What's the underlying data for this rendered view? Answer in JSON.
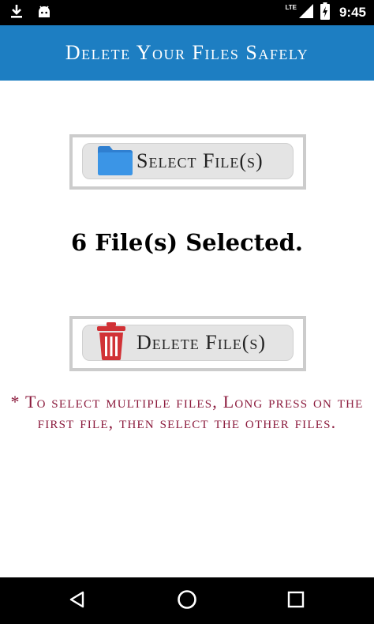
{
  "status_bar": {
    "network": "LTE",
    "time": "9:45",
    "icons": [
      "download-icon",
      "android-icon",
      "signal-icon",
      "battery-charging-icon"
    ]
  },
  "app_bar": {
    "title": "Delete Your Files Safely",
    "background_color": "#1d7ec2"
  },
  "select_button": {
    "label": "Select File(s)",
    "icon": "folder-icon",
    "icon_color": "#3b8fe0"
  },
  "selection_status": {
    "text": "6 File(s) Selected."
  },
  "delete_button": {
    "label": "Delete File(s)",
    "icon": "trash-icon",
    "icon_color": "#d13236"
  },
  "hint": {
    "text": "* To select multiple files, Long press on the first file, then select the other files.",
    "color": "#8b1a3c"
  },
  "nav_bar": {
    "icons": [
      "back-icon",
      "home-icon",
      "recents-icon"
    ]
  }
}
